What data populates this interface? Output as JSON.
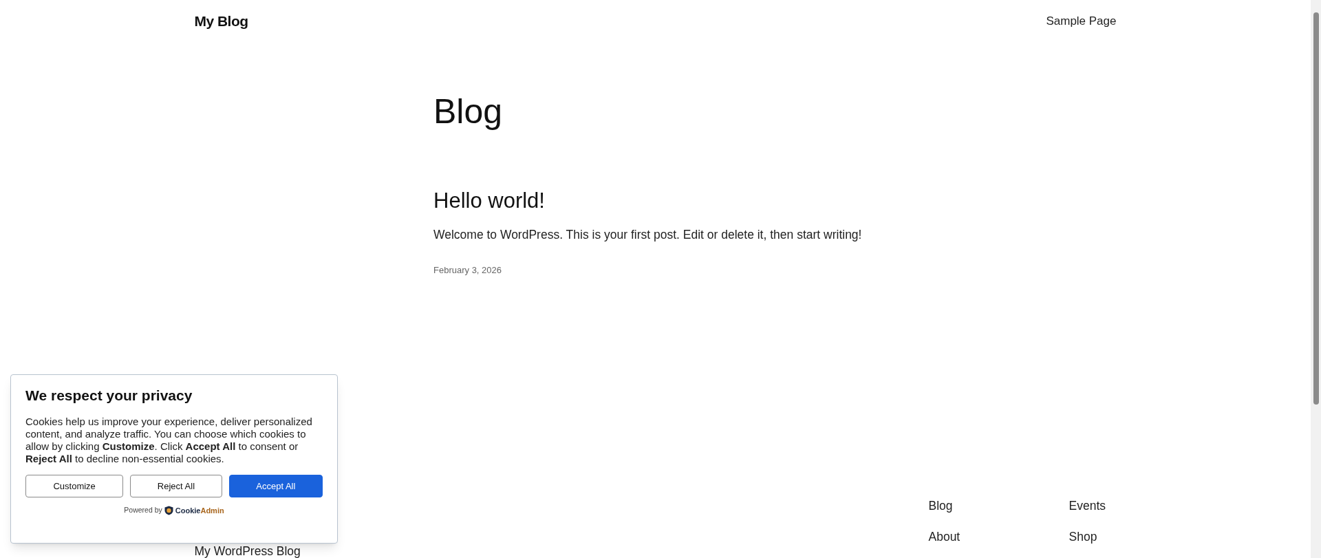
{
  "header": {
    "site_title": "My Blog",
    "nav": [
      "Sample Page"
    ]
  },
  "page_title": "Blog",
  "posts": [
    {
      "title": "Hello world!",
      "excerpt": "Welcome to WordPress. This is your first post. Edit or delete it, then start writing!",
      "date": "February 3, 2026"
    }
  ],
  "footer": {
    "site_title": "My WordPress Blog",
    "nav": [
      "Blog",
      "Events",
      "About",
      "Shop"
    ]
  },
  "cookie_banner": {
    "title": "We respect your privacy",
    "body": "Cookies help us improve your experience, deliver personalized content, and analyze traffic. You can choose which cookies to allow by clicking **Customize**. Click **Accept All** to consent or **Reject All** to decline non-essential cookies.",
    "buttons": [
      {
        "label": "Customize",
        "kind": "outline"
      },
      {
        "label": "Reject All",
        "kind": "outline"
      },
      {
        "label": "Accept All",
        "kind": "primary"
      }
    ],
    "powered_by": "Powered by",
    "brand_first": "Cookie",
    "brand_second": "Admin"
  }
}
